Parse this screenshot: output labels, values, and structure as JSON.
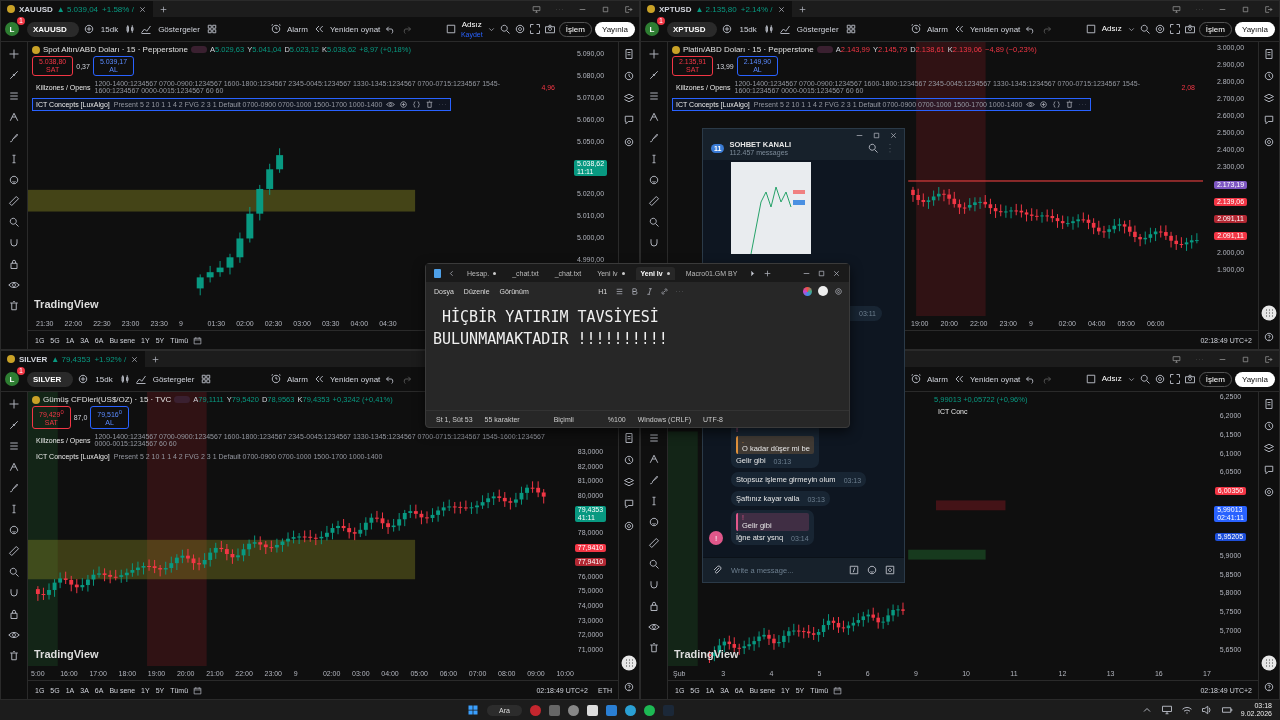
{
  "panes": [
    {
      "tab": {
        "symbol": "XAUUSD",
        "quote": "▲ 5.039,04",
        "change": "+1.58% /"
      },
      "toolbar": {
        "avatar": "L",
        "badge": "1",
        "symbol": "XAUUSD",
        "interval": "15dk",
        "indicators": "Göstergeler",
        "alarm": "Alarm",
        "replay": "Yeniden oynat",
        "layout": "Adsız",
        "layout_note": "Kaydet",
        "trade": "İşlem",
        "publish": "Yayınla"
      },
      "legend": {
        "title": "Spot Altın/ABD Doları · 15 · Pepperstone",
        "values": [
          {
            "label": "A",
            "value": "5.029,63"
          },
          {
            "label": "Y",
            "value": "5.041,04"
          },
          {
            "label": "D",
            "value": "5.023,12"
          },
          {
            "label": "K",
            "value": "5.038,62"
          }
        ],
        "change": "+8,97 (+0,18%)",
        "up": true
      },
      "quote_boxes": {
        "sell": "5.038,80",
        "sell_label": "SAT",
        "spread": "0,37",
        "buy": "5.039,17",
        "buy_label": "AL"
      },
      "indicators": [
        {
          "name": "Killzones / Opens",
          "params": "1200-1400:1234567 0700-0900:1234567 1600-1800:1234567 2345-0045:1234567 1330-1345:1234567 0700-0715:1234567 1545-1600:1234567 0000-0015:1234567 60 60",
          "value": "4,96",
          "selected": false
        },
        {
          "name": "ICT Concepts [LuxAlgo]",
          "params": "Present 5 2 10 1 1 4 2 FVG 2 3 1 Default 0700-0900 0700-1000 1500-1700 1000-1400",
          "selected": true
        }
      ],
      "price_labels": [
        {
          "kind": "tick",
          "text": "5.090,00"
        },
        {
          "kind": "tick",
          "text": "5.080,00"
        },
        {
          "kind": "tick",
          "text": "5.070,00"
        },
        {
          "kind": "tick",
          "text": "5.060,00"
        },
        {
          "kind": "tick",
          "text": "5.050,00"
        },
        {
          "kind": "tag",
          "text": "5.038,62",
          "sub": "11:11",
          "color": "#089981"
        },
        {
          "kind": "tick",
          "text": "5.020,00"
        },
        {
          "kind": "tick",
          "text": "5.010,00"
        },
        {
          "kind": "tick",
          "text": "5.000,00"
        },
        {
          "kind": "tick",
          "text": "4.990,00"
        }
      ],
      "time_ticks": [
        "21:30",
        "22:00",
        "22:30",
        "23:00",
        "23:30",
        "9",
        "01:30",
        "02:00",
        "02:30",
        "03:00",
        "03:30",
        "04:00",
        "04:30"
      ],
      "logo": "TradingView",
      "ranges": [
        "1G",
        "5G",
        "1A",
        "3A",
        "6A",
        "Bu sene",
        "1Y",
        "5Y",
        "Tümü"
      ]
    },
    {
      "tab": {
        "symbol": "XPTUSD",
        "quote": "▲ 2.135,80",
        "change": "+2.14% /"
      },
      "toolbar": {
        "avatar": "L",
        "badge": "1",
        "symbol": "XPTUSD",
        "interval": "15dk",
        "indicators": "Göstergeler",
        "alarm": "Alarm",
        "replay": "Yeniden oynat",
        "layout": "Adsız",
        "trade": "İşlem",
        "publish": "Yayınla"
      },
      "legend": {
        "title": "Platin/ABD Doları · 15 · Pepperstone",
        "values": [
          {
            "label": "A",
            "value": "2.143,99"
          },
          {
            "label": "Y",
            "value": "2.145,79"
          },
          {
            "label": "D",
            "value": "2.138,61"
          },
          {
            "label": "K",
            "value": "2.139,06"
          }
        ],
        "change": "−4,89 (−0,23%)",
        "up": false
      },
      "quote_boxes": {
        "sell": "2.135,91",
        "sell_label": "SAT",
        "spread": "13,99",
        "buy": "2.149,90",
        "buy_label": "AL"
      },
      "indicators": [
        {
          "name": "Killzones / Opens",
          "params": "1200-1400:1234567 0700-0900:1234567 1600-1800:1234567 2345-0045:1234567 1330-1345:1234567 0700-0715:1234567 1545-1600:1234567 0000-0015:1234567 60 60",
          "value": "2,08",
          "selected": false
        },
        {
          "name": "ICT Concepts [LuxAlgo]",
          "params": "Present 5 2 10 1 1 4 2 FVG 2 3 1 Default 0700-0900 0700-1000 1500-1700 1000-1400",
          "selected": true
        }
      ],
      "price_labels": [
        {
          "kind": "tick",
          "text": "3.000,00"
        },
        {
          "kind": "tick",
          "text": "2.900,00"
        },
        {
          "kind": "tick",
          "text": "2.800,00"
        },
        {
          "kind": "tick",
          "text": "2.700,00"
        },
        {
          "kind": "tick",
          "text": "2.600,00"
        },
        {
          "kind": "tick",
          "text": "2.500,00"
        },
        {
          "kind": "tick",
          "text": "2.400,00"
        },
        {
          "kind": "tick",
          "text": "2.300,00"
        },
        {
          "kind": "tag",
          "text": "2.173,19",
          "color": "#7e57c2"
        },
        {
          "kind": "tag",
          "text": "2.139,06",
          "color": "#f23645"
        },
        {
          "kind": "tag",
          "text": "2.091,11",
          "color": "#b22833"
        },
        {
          "kind": "tag",
          "text": "2.091,11",
          "color": "#f23645"
        },
        {
          "kind": "tick",
          "text": "2.000,00"
        },
        {
          "kind": "tick",
          "text": "1.900,00"
        }
      ],
      "time_ticks": [
        "19:00",
        "20:00",
        "22:00",
        "23:00",
        "9",
        "02:00",
        "04:00",
        "05:00",
        "06:00"
      ],
      "clock": "02:18:49 UTC+2"
    },
    {
      "tab": {
        "symbol": "SILVER",
        "quote": "▲ 79,4353",
        "change": "+1.92% /"
      },
      "toolbar": {
        "avatar": "L",
        "badge": "1",
        "symbol": "SILVER",
        "interval": "15dk",
        "indicators": "Göstergeler",
        "alarm": "Alarm",
        "replay": "Yeniden oynat"
      },
      "legend": {
        "title": "Gümüş CFDleri(US$/OZ) · 15 · TVC",
        "values": [
          {
            "label": "A",
            "value": "79,1111"
          },
          {
            "label": "Y",
            "value": "79,5420"
          },
          {
            "label": "D",
            "value": "78,9563"
          },
          {
            "label": "K",
            "value": "79,4353"
          }
        ],
        "change": "+0,3242 (+0,41%)",
        "up": true
      },
      "quote_boxes": {
        "sell": "79,429$^{0}$",
        "sell_label": "SAT",
        "spread": "87,0",
        "buy": "79,516$^{0}$",
        "buy_label": "AL"
      },
      "indicators": [
        {
          "name": "Killzones / Opens",
          "params": "1200-1400:1234567 0700-0900:1234567 1600-1800:1234567 2345-0045:1234567 1330-1345:1234567 0700-0715:1234567 1545-1600:1234567 0000-0015:1234567 60 60",
          "selected": false
        },
        {
          "name": "ICT Concepts [LuxAlgo]",
          "params": "Present 5 2 10 1 1 4 2 FVG 2 3 1 Default 0700-0900 0700-1000 1500-1700 1000-1400",
          "selected": false
        }
      ],
      "price_labels": [
        {
          "kind": "tick",
          "text": "83,0000"
        },
        {
          "kind": "tick",
          "text": "82,0000"
        },
        {
          "kind": "tick",
          "text": "81,0000"
        },
        {
          "kind": "tick",
          "text": "80,0000"
        },
        {
          "kind": "tag",
          "text": "79,4353",
          "sub": "41:11",
          "color": "#089981"
        },
        {
          "kind": "tick",
          "text": "78,0000"
        },
        {
          "kind": "tag",
          "text": "77,9410",
          "color": "#f23645"
        },
        {
          "kind": "tag",
          "text": "77,9410",
          "color": "#b22833"
        },
        {
          "kind": "tick",
          "text": "76,0000"
        },
        {
          "kind": "tick",
          "text": "75,0000"
        },
        {
          "kind": "tick",
          "text": "74,0000"
        },
        {
          "kind": "tick",
          "text": "73,0000"
        },
        {
          "kind": "tick",
          "text": "72,0000"
        },
        {
          "kind": "tick",
          "text": "71,0000"
        }
      ],
      "time_ticks": [
        "5:00",
        "16:00",
        "17:00",
        "18:00",
        "19:00",
        "20:00",
        "21:00",
        "22:00",
        "23:00",
        "9",
        "02:00",
        "03:00",
        "04:00",
        "05:00",
        "06:00",
        "07:00",
        "08:00",
        "09:00",
        "10:00"
      ],
      "logo": "TradingView",
      "ranges": [
        "1G",
        "5G",
        "1A",
        "3A",
        "6A",
        "Bu sene",
        "1Y",
        "5Y",
        "Tümü"
      ],
      "clock": "02:18:49 UTC+2",
      "session": "ETH"
    },
    {
      "toolbar": {
        "alarm": "Alarm",
        "replay": "Yeniden oynat",
        "layout": "Adsız",
        "trade": "İşlem",
        "publish": "Yayınla"
      },
      "legend": {
        "change": "5,99013 +0,05722 (+0,96%)",
        "up": true
      },
      "indicators": [
        {
          "name": "ICT Conc",
          "selected": false
        }
      ],
      "price_labels": [
        {
          "kind": "tick",
          "text": "6,2500"
        },
        {
          "kind": "tick",
          "text": "6,2000"
        },
        {
          "kind": "tick",
          "text": "6,1500"
        },
        {
          "kind": "tick",
          "text": "6,1000"
        },
        {
          "kind": "tick",
          "text": "6,0500"
        },
        {
          "kind": "tag",
          "text": "6,00350",
          "color": "#f23645"
        },
        {
          "kind": "tag",
          "text": "5,99013",
          "sub": "02:41:11",
          "color": "#2962ff"
        },
        {
          "kind": "tag",
          "text": "5,95205",
          "color": "#1e4fd8"
        },
        {
          "kind": "tick",
          "text": "5,9000"
        },
        {
          "kind": "tick",
          "text": "5,8500"
        },
        {
          "kind": "tick",
          "text": "5,8000"
        },
        {
          "kind": "tick",
          "text": "5,7500"
        },
        {
          "kind": "tick",
          "text": "5,7000"
        },
        {
          "kind": "tick",
          "text": "5,6500"
        }
      ],
      "time_ticks": [
        "Şub",
        "3",
        "4",
        "5",
        "6",
        "9",
        "10",
        "11",
        "12",
        "13",
        "16",
        "17"
      ],
      "logo": "TradingView",
      "ranges": [
        "1G",
        "5G",
        "1A",
        "3A",
        "6A",
        "Bu sene",
        "1Y",
        "5Y",
        "Tümü"
      ],
      "clock": "02:18:49 UTC+2"
    }
  ],
  "chat": {
    "badge": "11",
    "title": "SOHBET KANALI",
    "subtitle": "112.457 messages",
    "hidden_time": "03:11",
    "avatar": "!",
    "messages": [
      {
        "sender": "!",
        "reply": {
          "author": ".",
          "text": "O kadar düşer mi be",
          "color": "#e0913b"
        },
        "text": "Gelir gibi",
        "time": "03:13"
      },
      {
        "text": "Stopsuz işleme girmeyin olum",
        "time": "03:13"
      },
      {
        "text": "Şaftınız kayar valla",
        "time": "03:13"
      },
      {
        "reply": {
          "author": "!",
          "text": "Gelir gibi",
          "color": "#e0578a"
        },
        "text": "İğne atsr ysnq",
        "time": "03:14"
      }
    ],
    "input_placeholder": "Write a message..."
  },
  "notepad": {
    "tabs": [
      {
        "label": "Hesap.",
        "selected": false,
        "modified": true
      },
      {
        "label": "_chat.txt",
        "selected": false,
        "modified": false
      },
      {
        "label": "_chat.txt",
        "selected": false,
        "modified": false
      },
      {
        "label": "Yeni lv",
        "selected": false,
        "modified": true
      },
      {
        "label": "Yeni lv",
        "selected": true,
        "modified": true
      },
      {
        "label": "Macro01.GM  BY",
        "selected": false,
        "modified": false
      }
    ],
    "menus": [
      "Dosya",
      "Düzenle",
      "Görünüm"
    ],
    "heading": "H1",
    "lines": [
      " HİÇBİR YATIRIM TAVSİYESİ",
      "BULUNMAMAKTADIR !!!!!!!!!!"
    ],
    "status": {
      "position": "St 1, Süt 53",
      "count": "55 karakter",
      "format": "Biçimli",
      "zoom": "%100",
      "line_ending": "Windows (CRLF)",
      "encoding": "UTF-8"
    }
  },
  "taskbar": {
    "search": "Ara",
    "time": "03:18",
    "date": "9.02.2026"
  }
}
